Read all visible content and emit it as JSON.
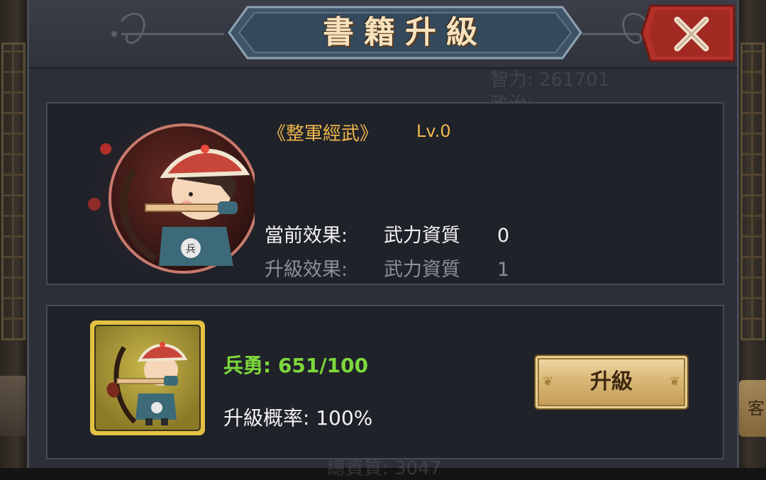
{
  "dialog": {
    "title": "書籍升級",
    "close_label": "✕"
  },
  "background": {
    "ghost_text_1": "智力:  261701",
    "ghost_text_2": "政治:",
    "ghost_text_3": "總資質: 3047",
    "side_button_text": "客房"
  },
  "book": {
    "title": "《整軍經武》",
    "level": "Lv.0",
    "icon": "archer-portrait-icon",
    "current_effect": {
      "label": "當前效果:",
      "stat": "武力資質",
      "value": "0"
    },
    "next_effect": {
      "label": "升級效果:",
      "stat": "武力資質",
      "value": "1"
    }
  },
  "upgrade": {
    "item_icon": "archer-soldier-icon",
    "resource_label": "兵勇:",
    "resource_value": "651/100",
    "chance_label": "升級概率:",
    "chance_value": "100%",
    "button_label": "升級"
  },
  "colors": {
    "accent_gold": "#f0b84a",
    "resource_green": "#7dd93b",
    "close_red": "#b4312a",
    "panel_bg": "#20222a"
  }
}
